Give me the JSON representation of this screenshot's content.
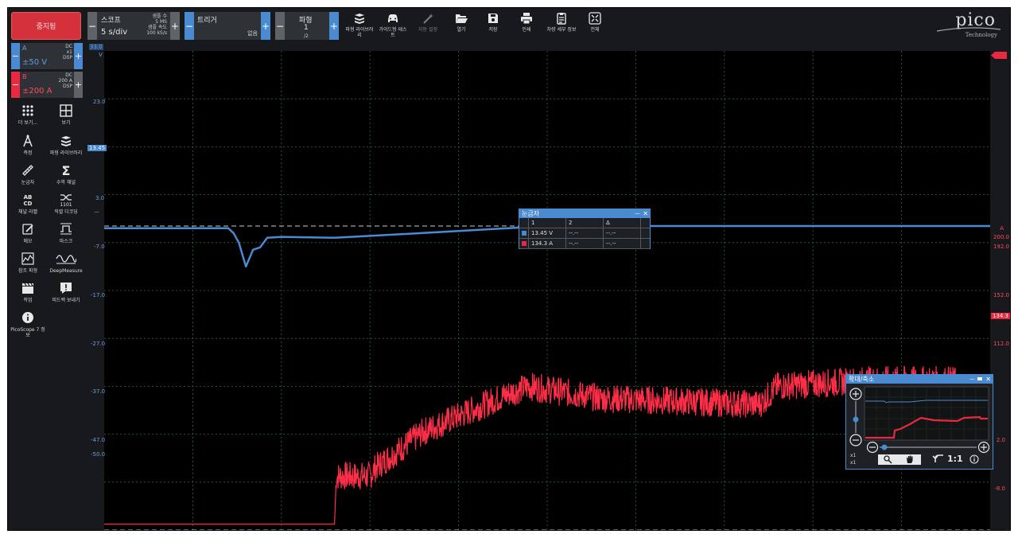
{
  "toolbar": {
    "stop_label": "중지됨",
    "scope": {
      "title": "스코프",
      "timebase": "5 s/div",
      "samples_label": "샘플 수",
      "samples_value": "5 MS",
      "rate_label": "샘플 속도",
      "rate_value": "100 kS/s",
      "minus": "−",
      "plus": "+"
    },
    "trigger": {
      "title": "트리거",
      "mode": "없음",
      "minus": "−",
      "plus": "+"
    },
    "waveform": {
      "title": "파형",
      "current": "1",
      "total": "/2",
      "minus": "−",
      "plus": "+"
    },
    "tools": [
      {
        "label": "파형 라이브러리",
        "icon": "books-icon"
      },
      {
        "label": "가이드형 테스트",
        "icon": "car-icon"
      },
      {
        "label": "자동 설정",
        "icon": "wand-icon"
      },
      {
        "label": "열기",
        "icon": "folder-open-icon"
      },
      {
        "label": "저장",
        "icon": "save-icon"
      },
      {
        "label": "인쇄",
        "icon": "print-icon"
      },
      {
        "label": "차량 세부 정보",
        "icon": "clipboard-icon"
      },
      {
        "label": "전체",
        "icon": "fullscreen-icon"
      }
    ],
    "logo": {
      "brand": "pico",
      "sub": "Technology"
    }
  },
  "channels": [
    {
      "name": "A",
      "coupling": "DC",
      "probe": "x1",
      "dsp": "DSP",
      "range": "±50 V",
      "color": "#4a8ad0",
      "minus": "−",
      "plus": "+"
    },
    {
      "name": "B",
      "coupling": "DC",
      "probe": "200 A",
      "dsp": "DSP",
      "range": "±200 A",
      "color": "#e8293f",
      "minus": "−",
      "plus": "+"
    }
  ],
  "side_tools": [
    {
      "label": "더 보기...",
      "icon": "dots-grid-icon"
    },
    {
      "label": "보기",
      "icon": "view-grid-icon"
    },
    {
      "label": "측정",
      "icon": "measure-icon"
    },
    {
      "label": "파형 라이브러리",
      "icon": "books-icon"
    },
    {
      "label": "눈금자",
      "icon": "ruler-icon"
    },
    {
      "label": "수학 채널",
      "icon": "sigma-icon"
    },
    {
      "label": "채널 라벨",
      "icon": "abcd-icon"
    },
    {
      "label": "직렬 디코딩",
      "icon": "serial-decode-icon"
    },
    {
      "label": "메모",
      "icon": "notes-icon"
    },
    {
      "label": "마스크",
      "icon": "mask-icon"
    },
    {
      "label": "참조 파형",
      "icon": "reference-waveform-icon"
    },
    {
      "label": "DeepMeasure",
      "icon": "deepmeasure-icon"
    },
    {
      "label": "작업",
      "icon": "clapperboard-icon"
    },
    {
      "label": "피드백 보내기",
      "icon": "feedback-icon"
    },
    {
      "label": "PicoScope 7 정보",
      "icon": "info-icon"
    }
  ],
  "axes": {
    "left_unit": "V",
    "left_top": "33.0",
    "left_ticks": [
      "23.0",
      "13.45",
      "3.0",
      "—",
      "-7.0",
      "-17.0",
      "-27.0",
      "-37.0",
      "-47.0",
      "-50.0"
    ],
    "right_unit": "A",
    "right_ticks": [
      "200.0",
      "192.0",
      "152.0",
      "134.3",
      "112.0",
      "2.0",
      "-8.0"
    ],
    "marker_a": "13.45",
    "marker_b": "134.3"
  },
  "rulers": {
    "title": "눈금자",
    "headers": [
      "1",
      "2",
      "Δ"
    ],
    "rows": [
      {
        "v1": "13.45 V",
        "v2": "--.--",
        "d": "--.--",
        "color": "#4a8ad0"
      },
      {
        "v1": "134.3 A",
        "v2": "--.--",
        "d": "--.--",
        "color": "#e8293f"
      }
    ],
    "close": "✕",
    "minimize": "—"
  },
  "zoom": {
    "title": "확대/축소",
    "x1a": "x1",
    "x1b": "x1",
    "one_to_one": "1:1",
    "close": "✕",
    "minimize": "—"
  },
  "chart_data": {
    "type": "line",
    "title": "",
    "xlabel": "",
    "x_unit": "s",
    "x_range": [
      0,
      50
    ],
    "series": [
      {
        "name": "A",
        "axis": "left",
        "unit": "V",
        "range": [
          -50,
          50
        ],
        "x": [
          0,
          7,
          7.3,
          7.6,
          8.0,
          8.4,
          8.8,
          9.2,
          10,
          13,
          18,
          25,
          30,
          40,
          50
        ],
        "y": [
          13.0,
          13.0,
          12.0,
          10.0,
          5.0,
          8.5,
          9.0,
          11.0,
          11.2,
          11.0,
          12.0,
          13.45,
          13.45,
          13.45,
          13.45
        ]
      },
      {
        "name": "B",
        "axis": "right",
        "unit": "A",
        "range": [
          -200,
          200
        ],
        "x": [
          0,
          13,
          13.1,
          15,
          15.3,
          18,
          23,
          24,
          28,
          37,
          38,
          43,
          44,
          48,
          48.1,
          50
        ],
        "y": [
          -195,
          -195,
          -155,
          -155,
          -148,
          -118,
          -85,
          -80,
          -90,
          -95,
          -80,
          -75,
          -75,
          -75,
          -82,
          -82
        ]
      }
    ]
  }
}
